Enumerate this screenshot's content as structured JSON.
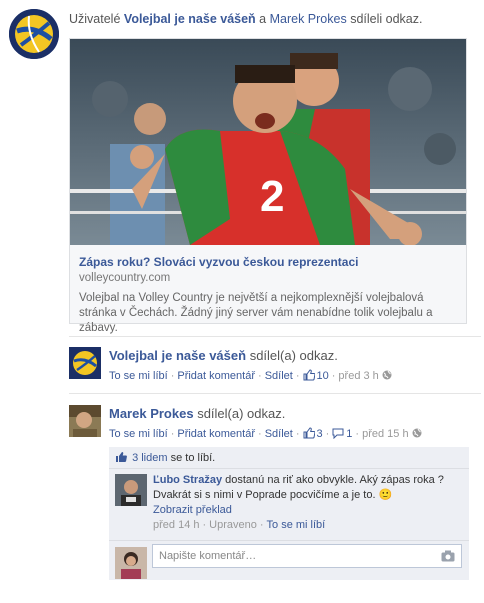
{
  "story": {
    "prefix": "Uživatelé",
    "page_name": "Volejbal je naše vášeň",
    "conj": "a",
    "user_name": "Marek Prokes",
    "action": "sdíleli odkaz."
  },
  "link_card": {
    "title": "Zápas roku? Slováci vyzvou českou reprezentaci",
    "domain": "volleycountry.com",
    "description": "Volejbal na Volley Country je největší a nejkomplexnější volejbalová stránka v Čechách. Žádný jiný server vám nenabídne tolik volejbalu a zábavy.",
    "jersey_number": "2"
  },
  "share1": {
    "name": "Volejbal je naše vášeň",
    "action": "sdílel(a) odkaz.",
    "like": "To se mi líbí",
    "comment": "Přidat komentář",
    "share": "Sdílet",
    "likes_count": "10",
    "time": "před 3 h"
  },
  "share2": {
    "name": "Marek Prokes",
    "action": "sdílel(a) odkaz.",
    "like": "To se mi líbí",
    "comment": "Přidat komentář",
    "share": "Sdílet",
    "likes_count": "3",
    "comments_count": "1",
    "time": "před 15 h"
  },
  "ufi": {
    "likers": "3 lidem",
    "likers_suffix": "se to líbí.",
    "comment": {
      "author": "Ľubo Stražay",
      "text": "dostanú na riť ako obvykle. Aký zápas roka ? Dvakrát si s nimi v Poprade pocvičíme a je to.",
      "emoticon": "🙂",
      "translate": "Zobrazit překlad",
      "time": "před 14 h",
      "edited": "Upraveno",
      "like": "To se mi líbí"
    },
    "input_placeholder": "Napište komentář…"
  },
  "colors": {
    "link": "#3b5998",
    "ufi_bg": "#edeff4",
    "jersey_red": "#d7302b",
    "jersey_green": "#2e8b3e"
  }
}
